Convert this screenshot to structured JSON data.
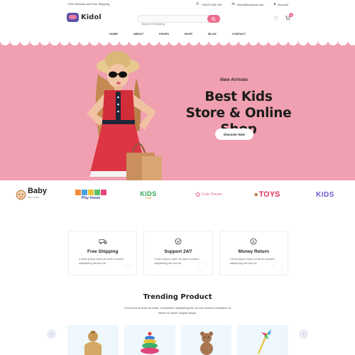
{
  "topbar": {
    "promo": "Free Refunds and Free Shipping",
    "phone": "+00123 456 789",
    "email": "demo@example.com",
    "account": "Account"
  },
  "header": {
    "brand": "Kidol",
    "search_placeholder": "Search Everything",
    "cart_count": "0"
  },
  "nav": [
    "HOME",
    "ABOUT",
    "PAGES",
    "SHOP",
    "BLOG",
    "CONTACT"
  ],
  "hero": {
    "eyebrow": "New Arrivals",
    "title": "Best Kids Store & Online Shop",
    "button": "Discover Now"
  },
  "brands": {
    "baby": "Baby",
    "baby_sub": "BABY STORE",
    "play": "Play house",
    "kids": "KIDS",
    "kids_sub": "STORE",
    "cute": "Cute Dream",
    "toys": "TOYS",
    "kids2": "KIDS"
  },
  "features": [
    {
      "title": "Free Shipping",
      "desc": "Lorem ipsum dolor sit amet consect adipisicing elit sed do",
      "icon": "truck-icon"
    },
    {
      "title": "Support 24/7",
      "desc": "Lorem ipsum dolor sit amet consect adipisicing elit sed do",
      "icon": "support-icon"
    },
    {
      "title": "Money Return",
      "desc": "Lorem ipsum dolor sit amet consect adipisicing elit sed do",
      "icon": "money-icon"
    }
  ],
  "trending": {
    "title": "Trending Product",
    "desc": "Lorem ipsum dolor sit amet, consectetur adipisicing elit, sed do eiusmod incididunt ut labore et dolore magna aliqua."
  },
  "colors": {
    "accent": "#ee6c8d",
    "hero_bg": "#f0a0b0",
    "product_bg": "#eef7fb"
  }
}
